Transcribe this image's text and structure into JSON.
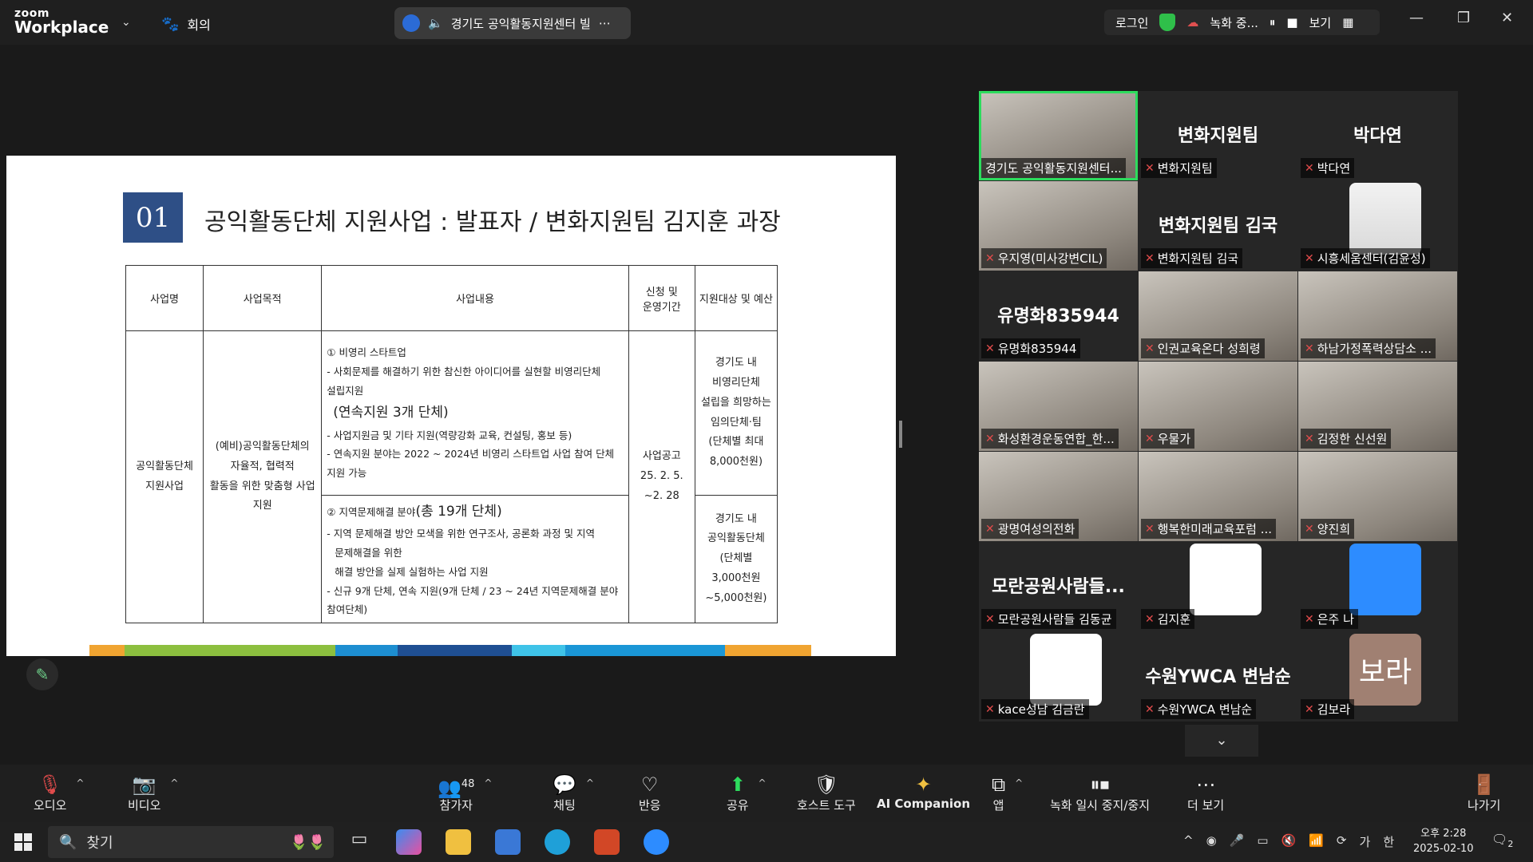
{
  "app": {
    "brand_top": "zoom",
    "brand_bottom": "Workplace",
    "meetings_label": "회의"
  },
  "title_chip": {
    "text": "경기도 공익활동지원센터 빌"
  },
  "top_right": {
    "login": "로그인",
    "recording": "녹화 중...",
    "view": "보기"
  },
  "slide": {
    "number": "01",
    "title": "공익활동단체 지원사업 : 발표자 / 변화지원팀 김지훈 과장",
    "headers": [
      "사업명",
      "사업목적",
      "사업내용",
      "신청 및\n운영기간",
      "지원대상 및 예산"
    ],
    "business_name": "공익활동단체\n지원사업",
    "purpose": "(예비)공익활동단체의\n자율적, 협력적\n활동을 위한 맞춤형 사업\n지원",
    "content_1_title": "① 비영리 스타트업",
    "content_1_l1": "- 사회문제를 해결하기 위한 참신한 아이디어를 실현할 비영리단체",
    "content_1_l2": "설립지원",
    "content_1_big": "(연속지원 3개 단체)",
    "content_1_l3": "- 사업지원금 및 기타 지원(역량강화 교육, 컨설팅, 홍보 등)",
    "content_1_l4": "- 연속지원 분야는 2022 ~ 2024년 비영리 스타트업 사업 참여 단체 지원 가능",
    "content_2_title_a": "② 지역문제해결 분야",
    "content_2_title_b": "(총 19개 단체)",
    "content_2_l1": "- 지역 문제해결 방안 모색을 위한 연구조사, 공론화 과정 및 지역",
    "content_2_l2": "문제해결을 위한",
    "content_2_l3": "해결 방안을 실제 실험하는 사업 지원",
    "content_2_l4": "- 신규 9개 단체, 연속 지원(9개 단체 / 23 ~ 24년 지역문제해결 분야 참여단체)",
    "period": "사업공고\n25. 2. 5.\n~2. 28",
    "target_1": "경기도 내\n비영리단체\n설립을 희망하는\n임의단체·팀\n(단체별 최대\n8,000천원)",
    "target_2": "경기도 내\n공익활동단체\n(단체별\n3,000천원\n~5,000천원)"
  },
  "participants": [
    {
      "name": "경기도 공익활동지원센터...",
      "big": "",
      "type": "cam"
    },
    {
      "name": "변화지원팀",
      "big": "변화지원팀",
      "type": "text"
    },
    {
      "name": "박다연",
      "big": "박다연",
      "type": "text"
    },
    {
      "name": "우지영(미사강변CIL)",
      "big": "",
      "type": "cam"
    },
    {
      "name": "변화지원팀 김국",
      "big": "변화지원팀 김국",
      "type": "text"
    },
    {
      "name": "시흥세움센터(김윤성)",
      "big": "",
      "type": "avatar"
    },
    {
      "name": "유명화835944",
      "big": "유명화835944",
      "type": "text"
    },
    {
      "name": "인권교육온다 성희령",
      "big": "",
      "type": "cam"
    },
    {
      "name": "하남가정폭력상담소 ...",
      "big": "",
      "type": "cam"
    },
    {
      "name": "화성환경운동연합_한...",
      "big": "",
      "type": "cam"
    },
    {
      "name": "우물가",
      "big": "",
      "type": "cam"
    },
    {
      "name": "김정한 신선원",
      "big": "",
      "type": "cam"
    },
    {
      "name": "광명여성의전화",
      "big": "",
      "type": "cam"
    },
    {
      "name": "행복한미래교육포럼 ...",
      "big": "",
      "type": "cam"
    },
    {
      "name": "양진희",
      "big": "",
      "type": "cam"
    },
    {
      "name": "모란공원사람들 김동균",
      "big": "모란공원사람들...",
      "type": "text"
    },
    {
      "name": "김지훈",
      "big": "",
      "type": "avatar"
    },
    {
      "name": "은주 나",
      "big": "",
      "type": "avatar"
    },
    {
      "name": "kace성남 김금란",
      "big": "",
      "type": "avatar"
    },
    {
      "name": "수원YWCA 변남순",
      "big": "수원YWCA 변남순",
      "type": "text"
    },
    {
      "name": "김보라",
      "big": "",
      "type": "avatar"
    }
  ],
  "avatar_label_bora": "보라",
  "toolbar": {
    "audio": "오디오",
    "video": "비디오",
    "participants": "참가자",
    "participants_count": "48",
    "chat": "채팅",
    "reactions": "반응",
    "share": "공유",
    "host_tools": "호스트 도구",
    "ai_companion": "AI Companion",
    "apps": "앱",
    "rec_pause": "녹화 일시 중지/중지",
    "more": "더 보기",
    "leave": "나가기"
  },
  "taskbar": {
    "search": "찾기",
    "time": "오후 2:28",
    "date": "2025-02-10",
    "ime": "한",
    "ime2": "가",
    "notif": "2"
  }
}
